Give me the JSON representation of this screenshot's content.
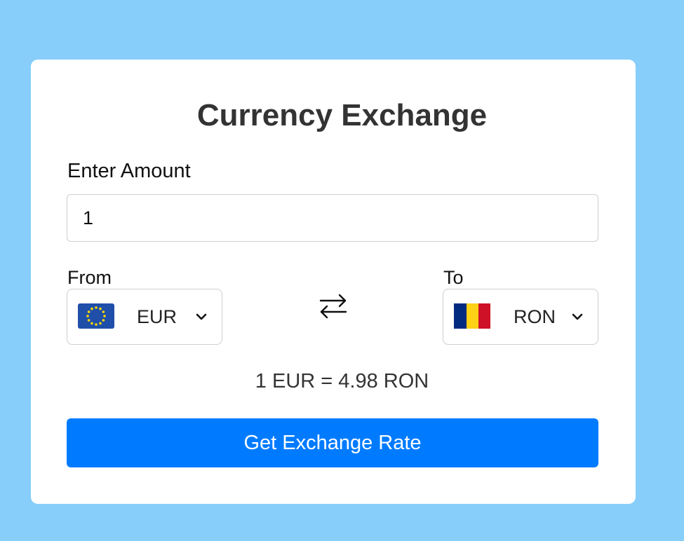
{
  "app": {
    "title": "Currency Exchange"
  },
  "amount": {
    "label": "Enter Amount",
    "value": "1"
  },
  "from": {
    "label": "From",
    "currency": "EUR",
    "flag_icon": "eu-flag-icon"
  },
  "to": {
    "label": "To",
    "currency": "RON",
    "flag_icon": "romania-flag-icon"
  },
  "swap": {
    "icon": "swap-arrows-icon"
  },
  "result": {
    "text": "1 EUR = 4.98 RON"
  },
  "actions": {
    "submit_label": "Get Exchange Rate"
  },
  "colors": {
    "background": "#87cefa",
    "card": "#ffffff",
    "accent": "#007bff"
  }
}
